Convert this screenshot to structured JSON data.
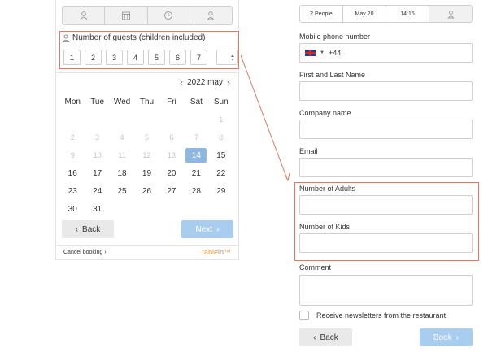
{
  "left": {
    "step_tabs": [
      {
        "icon": "people-icon"
      },
      {
        "icon": "calendar-icon"
      },
      {
        "icon": "clock-icon"
      },
      {
        "icon": "person-icon"
      }
    ],
    "guests_label": "Number of guests (children included)",
    "guest_options": [
      "1",
      "2",
      "3",
      "4",
      "5",
      "6",
      "7"
    ],
    "calendar": {
      "month_label": "2022 may",
      "weekdays": [
        "Mon",
        "Tue",
        "Wed",
        "Thu",
        "Fri",
        "Sat",
        "Sun"
      ],
      "rows": [
        [
          "",
          "",
          "",
          "",
          "",
          "",
          "1"
        ],
        [
          "2",
          "3",
          "4",
          "5",
          "6",
          "7",
          "8"
        ],
        [
          "9",
          "10",
          "11",
          "12",
          "13",
          "14",
          "15"
        ],
        [
          "16",
          "17",
          "18",
          "19",
          "20",
          "21",
          "22"
        ],
        [
          "23",
          "24",
          "25",
          "26",
          "27",
          "28",
          "29"
        ],
        [
          "30",
          "31",
          "",
          "",
          "",
          "",
          ""
        ]
      ],
      "disabled_until": 13,
      "selected": "14"
    },
    "back_label": "Back",
    "next_label": "Next",
    "cancel_label": "Cancel booking",
    "brand_a": "table",
    "brand_b": "in"
  },
  "right": {
    "tabs": [
      "2 People",
      "May 20",
      "14:15"
    ],
    "phone_label": "Mobile phone number",
    "phone_prefix": "+44",
    "name_label": "First and Last Name",
    "company_label": "Company name",
    "email_label": "Email",
    "adults_label": "Number of Adults",
    "kids_label": "Number of Kids",
    "comment_label": "Comment",
    "newsletter_label": "Receive newsletters from the restaurant.",
    "back_label": "Back",
    "book_label": "Book"
  },
  "colors": {
    "highlight": "#e07a5f",
    "primary_button": "#a9cdef",
    "selected_day": "#8fb8e0",
    "brand": "#e8a040"
  }
}
